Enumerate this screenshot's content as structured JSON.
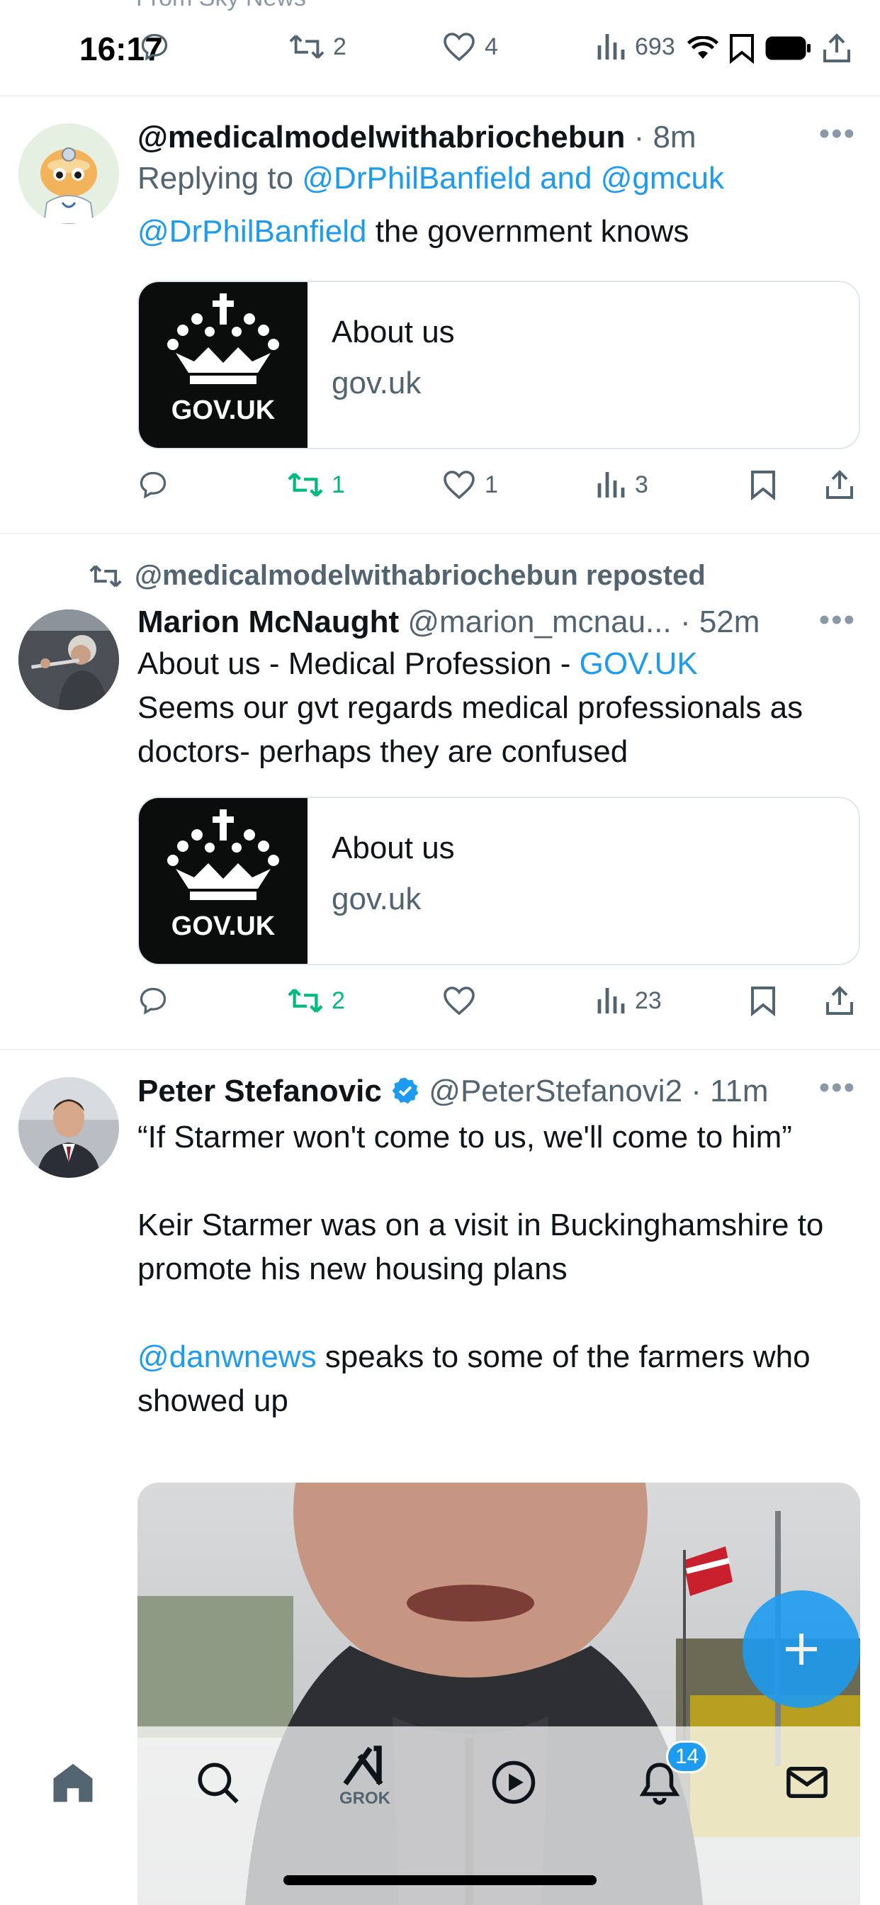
{
  "status": {
    "time": "16:17",
    "faded_source": "From Sky News"
  },
  "top_actions": {
    "retweets": "2",
    "likes": "4",
    "views": "693"
  },
  "tweets": [
    {
      "name": "@medicalmodelwithabriochebun",
      "time": "8m",
      "replying_prefix": "Replying to",
      "replying_to": "@DrPhilBanfield and @gmcuk",
      "mention": "@DrPhilBanfield",
      "text": " the government knows",
      "card": {
        "logo_text": "GOV.UK",
        "title": "About us",
        "domain": "gov.uk"
      },
      "retweets": "1",
      "likes": "1",
      "views": "3"
    },
    {
      "reposted_by": "@medicalmodelwithabriochebun reposted",
      "name": "Marion McNaught",
      "handle": "@marion_mcnau...",
      "time": "52m",
      "line1_prefix": "About us - Medical Profession - ",
      "line1_link": "GOV.UK",
      "line2": "Seems our gvt regards medical professionals as doctors- perhaps they are confused",
      "card": {
        "logo_text": "GOV.UK",
        "title": "About us",
        "domain": "gov.uk"
      },
      "retweets": "2",
      "views": "23"
    },
    {
      "name": "Peter Stefanovic",
      "handle": "@PeterStefanovi2",
      "time": "11m",
      "para1": "“If Starmer won't come to us, we'll come to him”",
      "para2": "Keir Starmer was on a visit in Buckinghamshire to promote his new housing plans",
      "para3_mention": "@danwnews",
      "para3_rest": " speaks to some of the farmers who showed up"
    }
  ],
  "tabbar": {
    "grok_label": "GROK",
    "notifications_badge": "14"
  },
  "colors": {
    "accent": "#1d9bf0",
    "retweet_green": "#00ba7c",
    "muted": "#536471"
  },
  "icons": [
    "reply-icon",
    "retweet-icon",
    "like-icon",
    "views-icon",
    "bookmark-icon",
    "share-icon",
    "more-icon",
    "verified-icon",
    "home-icon",
    "search-icon",
    "grok-icon",
    "video-icon",
    "notifications-icon",
    "messages-icon",
    "compose-icon"
  ]
}
